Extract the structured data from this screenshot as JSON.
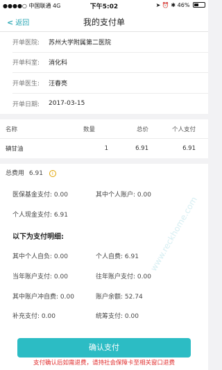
{
  "status_bar": {
    "carrier": "中国联通",
    "network": "4G",
    "time": "下午5:02",
    "battery_text": "46%",
    "battery_level": 0.46
  },
  "nav": {
    "back_label": "返回",
    "title": "我的支付单"
  },
  "info": {
    "rows": [
      {
        "label": "开单医院:",
        "value": "苏州大学附属第二医院"
      },
      {
        "label": "开单科室:",
        "value": "消化科"
      },
      {
        "label": "开单医生:",
        "value": "汪春亮"
      },
      {
        "label": "开单日期:",
        "value": "2017-03-15"
      }
    ]
  },
  "table": {
    "headers": [
      "名称",
      "数量",
      "总价",
      "个人支付"
    ],
    "rows": [
      {
        "name": "碘甘油",
        "qty": "1",
        "total": "6.91",
        "personal": "6.91"
      }
    ]
  },
  "summary": {
    "total_label": "总费用",
    "total_value": "6.91",
    "medical_fund_label": "医保基金支付:",
    "medical_fund_value": "0.00",
    "personal_account_label": "其中个人账户:",
    "personal_account_value": "0.00",
    "personal_cash_label": "个人现金支付:",
    "personal_cash_value": "6.91",
    "details_title": "以下为支付明细:",
    "details": [
      {
        "label": "其中个人自负:",
        "value": "0.00"
      },
      {
        "label": "个人自费:",
        "value": "6.91"
      },
      {
        "label": "当年账户支付:",
        "value": "0.00"
      },
      {
        "label": "往年账户支付:",
        "value": "0.00"
      },
      {
        "label": "其中账户冲自费:",
        "value": "0.00"
      },
      {
        "label": "账户余额:",
        "value": "52.74"
      },
      {
        "label": "补充支付:",
        "value": "0.00"
      },
      {
        "label": "统筹支付:",
        "value": "0.00"
      }
    ]
  },
  "actions": {
    "confirm_label": "确认支付",
    "refund_note": "支付确认后如需退费，请持社会保障卡至相关窗口退费"
  },
  "watermark_text": "www.reckhome.com",
  "colors": {
    "accent": "#2cbcc4",
    "back_text": "#2aa7b4",
    "warning": "#e03030",
    "info_icon": "#e0a300"
  }
}
